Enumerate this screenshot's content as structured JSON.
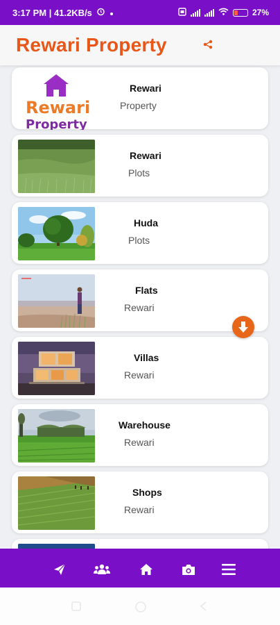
{
  "status_bar": {
    "time": "3:17 PM | 41.2KB/s",
    "battery": "27",
    "battery_level": 0.27
  },
  "header": {
    "title": "Rewari Property",
    "share_icon": "share-icon"
  },
  "logo": {
    "line1": "Rewari",
    "line2": "Property"
  },
  "listings": [
    {
      "title": "Rewari",
      "subtitle": "Property",
      "image": "logo"
    },
    {
      "title": "Rewari",
      "subtitle": "Plots",
      "image": "grass-field"
    },
    {
      "title": "Huda",
      "subtitle": "Plots",
      "image": "tree-park"
    },
    {
      "title": "Flats",
      "subtitle": "Rewari",
      "image": "beach-person"
    },
    {
      "title": "Villas",
      "subtitle": "Rewari",
      "image": "modern-villa"
    },
    {
      "title": "Warehouse",
      "subtitle": "Rewari",
      "image": "green-barn"
    },
    {
      "title": "Shops",
      "subtitle": "Rewari",
      "image": "farm-field"
    }
  ],
  "fab": {
    "icon": "arrow-down-icon",
    "color": "#e8661a"
  },
  "bottom_nav": {
    "items": [
      {
        "icon": "send-icon"
      },
      {
        "icon": "users-icon"
      },
      {
        "icon": "home-icon"
      },
      {
        "icon": "camera-icon"
      },
      {
        "icon": "menu-icon"
      }
    ]
  },
  "colors": {
    "brand_purple": "#7a0fc8",
    "title_orange": "#e8571a"
  }
}
